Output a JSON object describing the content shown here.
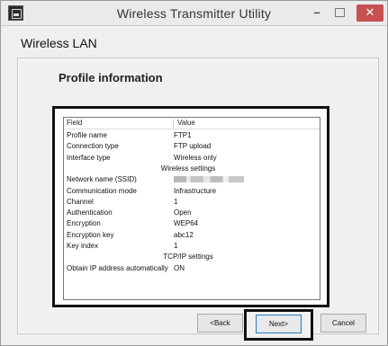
{
  "window": {
    "title": "Wireless Transmitter Utility",
    "minimize_glyph": "–",
    "close_glyph": "✕"
  },
  "section_title": "Wireless LAN",
  "page_heading": "Profile information",
  "table": {
    "header_field": "Field",
    "header_value": "Value",
    "rows": [
      {
        "field": "Profile name",
        "value": "FTP1"
      },
      {
        "field": "Connection type",
        "value": "FTP upload"
      },
      {
        "field": "Interface type",
        "value": "Wireless only"
      },
      {
        "section": "Wireless settings"
      },
      {
        "field": "Network name (SSID)",
        "value_redacted": true
      },
      {
        "field": "Communication mode",
        "value": "Infrastructure"
      },
      {
        "field": "Channel",
        "value": "1"
      },
      {
        "field": "Authentication",
        "value": "Open"
      },
      {
        "field": "Encryption",
        "value": "WEP64"
      },
      {
        "field": "Encryption key",
        "value": "abc12"
      },
      {
        "field": "Key index",
        "value": "1"
      },
      {
        "section": "TCP/IP settings"
      },
      {
        "field": "Obtain IP address automatically",
        "value": "ON"
      }
    ]
  },
  "buttons": {
    "back": "<Back",
    "next": "Next>",
    "cancel": "Cancel"
  },
  "colors": {
    "close_button": "#c75050",
    "default_button_border": "#3c7fb1",
    "highlight_frame": "#111111"
  }
}
